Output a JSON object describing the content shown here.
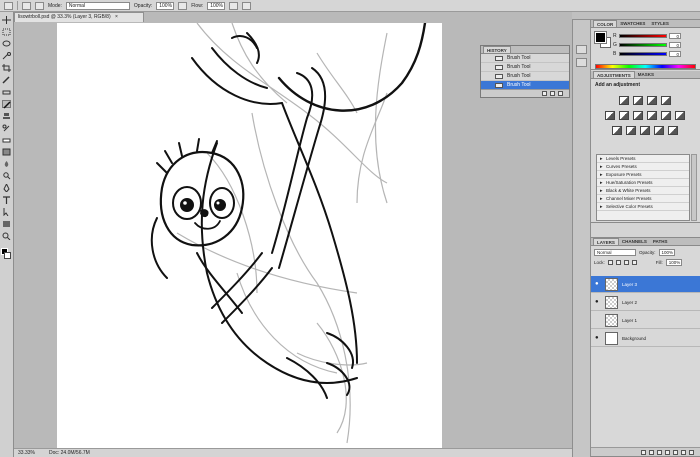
{
  "options_bar": {
    "mode_label": "Mode:",
    "mode_value": "Normal",
    "opacity_label": "Opacity:",
    "opacity_value": "100%",
    "flow_label": "Flow:",
    "flow_value": "100%"
  },
  "document": {
    "tab_title": "lisowtrboll.psd @ 33.3% (Layer 3, RGB/8)",
    "tab_close": "×",
    "zoom": "33.33%",
    "doc_size": "Doc: 24.0M/56.7M"
  },
  "history": {
    "tabs": [
      "HISTORY"
    ],
    "items": [
      "Brush Tool",
      "Brush Tool",
      "Brush Tool",
      "Brush Tool"
    ],
    "active_index": 3
  },
  "color_panel": {
    "tabs": [
      "COLOR",
      "SWATCHES",
      "STYLES"
    ],
    "sliders": [
      {
        "letter": "R",
        "value": "0",
        "gradient": "linear-gradient(to right, #000, #f00)"
      },
      {
        "letter": "G",
        "value": "0",
        "gradient": "linear-gradient(to right, #000, #0f0)"
      },
      {
        "letter": "B",
        "value": "0",
        "gradient": "linear-gradient(to right, #000, #00f)"
      }
    ]
  },
  "adjustments": {
    "tabs": [
      "ADJUSTMENTS",
      "MASKS"
    ],
    "title": "Add an adjustment",
    "presets": [
      "Levels Presets",
      "Curves Presets",
      "Exposure Presets",
      "Hue/Saturation Presets",
      "Black & White Presets",
      "Channel Mixer Presets",
      "Selective Color Presets"
    ]
  },
  "layers": {
    "tabs": [
      "LAYERS",
      "CHANNELS",
      "PATHS"
    ],
    "blend_mode": "Normal",
    "opacity_label": "Opacity:",
    "opacity_value": "100%",
    "lock_label": "Lock:",
    "fill_label": "Fill:",
    "fill_value": "100%",
    "items": [
      {
        "name": "Layer 3",
        "active": true,
        "visible": true
      },
      {
        "name": "Layer 2",
        "active": false,
        "visible": true
      },
      {
        "name": "Layer 1",
        "active": false,
        "visible": false
      },
      {
        "name": "Background",
        "active": false,
        "visible": true
      }
    ]
  },
  "colors": {
    "selection": "#3b77d6",
    "chrome": "#d4d4d4",
    "canvas": "#ffffff"
  }
}
